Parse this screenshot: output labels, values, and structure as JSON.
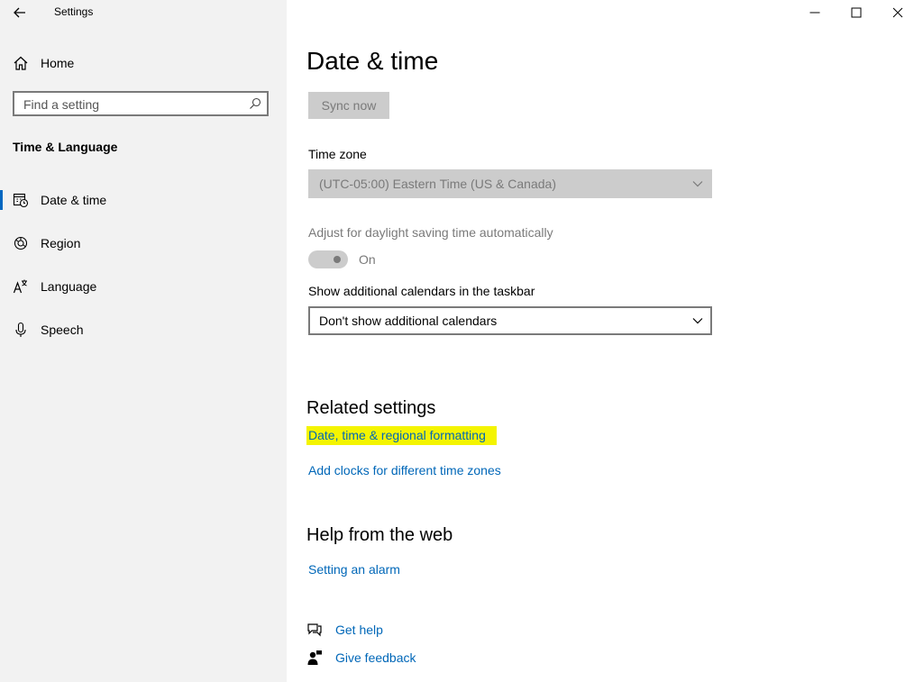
{
  "window": {
    "title": "Settings"
  },
  "sidebar": {
    "home_label": "Home",
    "search_placeholder": "Find a setting",
    "section_title": "Time & Language",
    "items": [
      {
        "label": "Date & time",
        "selected": true
      },
      {
        "label": "Region"
      },
      {
        "label": "Language"
      },
      {
        "label": "Speech"
      }
    ]
  },
  "main": {
    "page_title": "Date & time",
    "sync_label": "Sync now",
    "time_zone": {
      "label": "Time zone",
      "value": "(UTC-05:00) Eastern Time (US & Canada)"
    },
    "daylight": {
      "label": "Adjust for daylight saving time automatically",
      "state": "On"
    },
    "calendars": {
      "label": "Show additional calendars in the taskbar",
      "value": "Don't show additional calendars"
    },
    "related": {
      "title": "Related settings",
      "links": [
        "Date, time & regional formatting",
        "Add clocks for different time zones"
      ]
    },
    "help": {
      "title": "Help from the web",
      "links": [
        "Setting an alarm"
      ]
    },
    "support": {
      "get_help": "Get help",
      "give_feedback": "Give feedback"
    }
  },
  "colors": {
    "accent": "#0067c0",
    "link": "#0067b8",
    "highlight": "#f4f400",
    "sidebar_bg": "#f2f2f2",
    "disabled_bg": "#cccccc"
  }
}
